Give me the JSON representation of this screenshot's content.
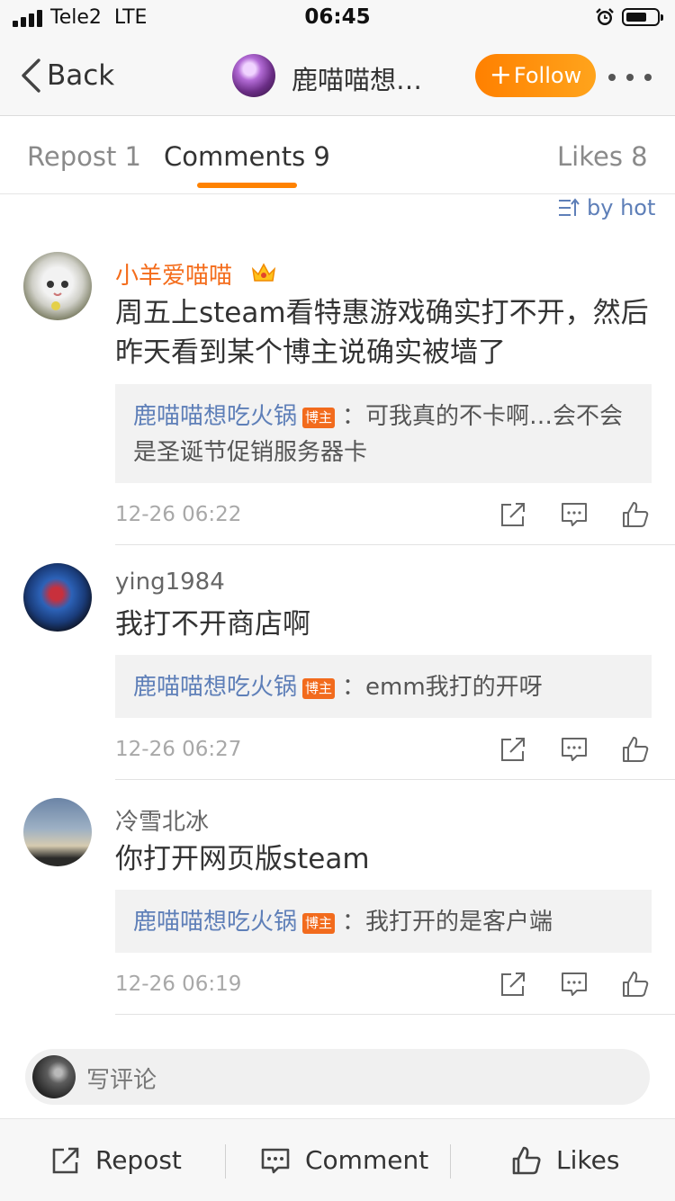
{
  "status_bar": {
    "carrier": "Tele2",
    "network": "LTE",
    "time": "06:45"
  },
  "nav": {
    "back_label": "Back",
    "title": "鹿喵喵想…",
    "follow_label": "Follow"
  },
  "tabs": {
    "repost": "Repost 1",
    "comments": "Comments 9",
    "likes": "Likes 8"
  },
  "sort": {
    "label": "by hot"
  },
  "comments": [
    {
      "user": "小羊爱喵喵",
      "text": "周五上steam看特惠游戏确实打不开，然后昨天看到某个博主说确实被墙了",
      "reply": {
        "user": "鹿喵喵想吃火锅",
        "badge": "博主",
        "text": "：可我真的不卡啊…会不会是圣诞节促销服务器卡"
      },
      "time": "12-26 06:22"
    },
    {
      "user": "ying1984",
      "text": "我打不开商店啊",
      "reply": {
        "user": "鹿喵喵想吃火锅",
        "badge": "博主",
        "text": "：emm我打的开呀"
      },
      "time": "12-26 06:27"
    },
    {
      "user": "冷雪北冰",
      "text": "你打开网页版steam",
      "reply": {
        "user": "鹿喵喵想吃火锅",
        "badge": "博主",
        "text": "：我打开的是客户端"
      },
      "time": "12-26 06:19"
    }
  ],
  "compose": {
    "placeholder": "写评论"
  },
  "toolbar": {
    "repost": "Repost",
    "comment": "Comment",
    "likes": "Likes"
  },
  "colors": {
    "accent": "#ff8200",
    "link": "#5e7fb8",
    "vip_name": "#f46c1b",
    "badge": "#f26b1d"
  }
}
